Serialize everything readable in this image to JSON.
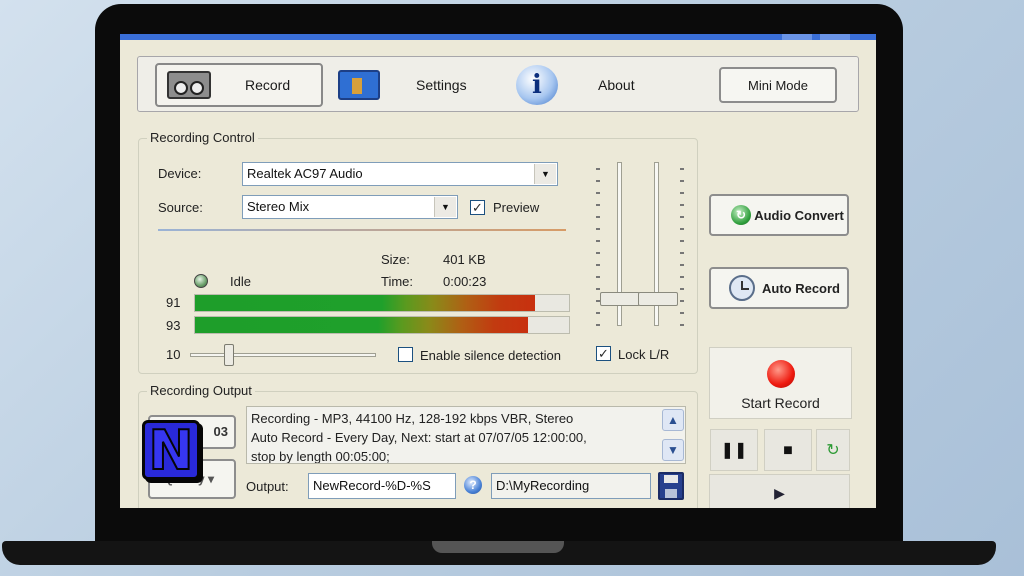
{
  "toolbar": {
    "record_label": "Record",
    "settings_label": "Settings",
    "about_label": "About",
    "mini_mode_label": "Mini Mode"
  },
  "recording_control": {
    "title": "Recording Control",
    "device_label": "Device:",
    "device_value": "Realtek AC97 Audio",
    "source_label": "Source:",
    "source_value": "Stereo Mix",
    "preview_label": "Preview",
    "preview_checked": true,
    "status": "Idle",
    "size_label": "Size:",
    "size_value": "401 KB",
    "time_label": "Time:",
    "time_value": "0:00:23",
    "meter_left_value": "91",
    "meter_right_value": "93",
    "meter_left_level": 0.91,
    "meter_right_level": 0.89,
    "silence_threshold": "10",
    "silence_label": "Enable silence detection",
    "silence_checked": false,
    "lock_label": "Lock L/R",
    "lock_checked": true
  },
  "side_buttons": {
    "audio_convert": "Audio Convert",
    "auto_record": "Auto Record",
    "start_record": "Start Record"
  },
  "recording_output": {
    "title": "Recording Output",
    "format_button": "03",
    "quality_button": "Quality",
    "info_lines": [
      "Recording - MP3, 44100 Hz, 128-192 kbps VBR, Stereo",
      "Auto Record - Every Day, Next: start at 07/07/05 12:00:00,",
      "stop by length 00:05:00;"
    ],
    "output_label": "Output:",
    "output_filename": "NewRecord-%D-%S",
    "output_folder": "D:\\MyRecording"
  },
  "logo": {
    "letter": "N"
  },
  "colors": {
    "window_bg": "#ece9d8",
    "record_red": "#ee1a0f",
    "meter_green": "#1e9e2a",
    "meter_red": "#c8300f",
    "logo_blue": "#2929d8"
  },
  "icons": {
    "record": "cassette-tape-icon",
    "settings": "folder-settings-icon",
    "about": "info-icon",
    "audio_convert": "convert-icon",
    "auto_record": "clock-icon",
    "pause": "pause-icon",
    "stop": "stop-icon",
    "play": "play-icon",
    "save": "save-disk-icon",
    "help": "help-icon"
  }
}
